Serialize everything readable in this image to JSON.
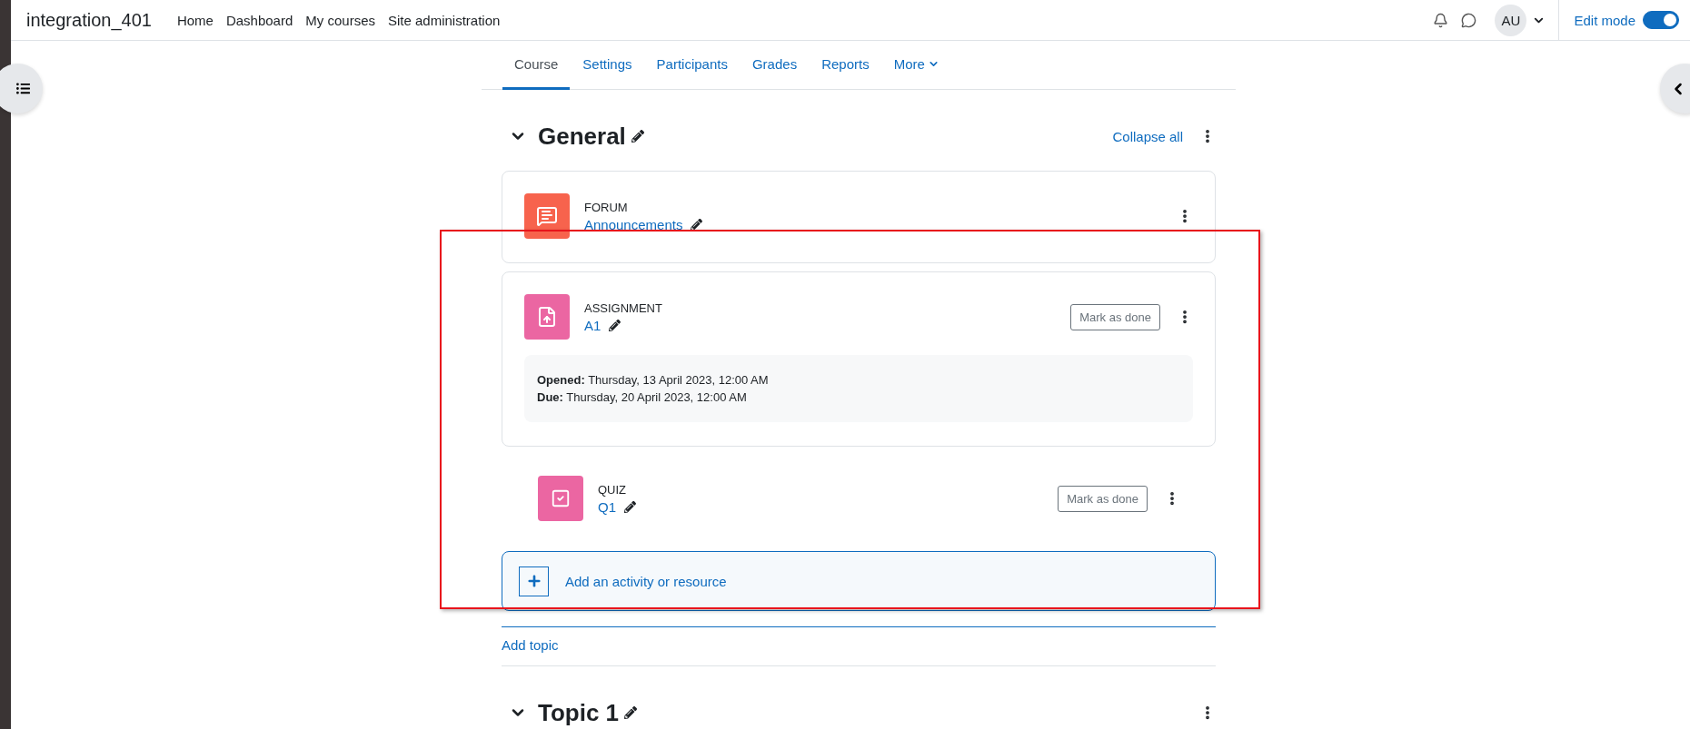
{
  "site_name": "integration_401",
  "nav_links": [
    "Home",
    "Dashboard",
    "My courses",
    "Site administration"
  ],
  "user": {
    "initials": "AU"
  },
  "edit_mode": {
    "label": "Edit mode",
    "on": true
  },
  "tabs": [
    {
      "label": "Course",
      "selected": true,
      "kind": "link"
    },
    {
      "label": "Settings",
      "selected": false,
      "kind": "link"
    },
    {
      "label": "Participants",
      "selected": false,
      "kind": "link"
    },
    {
      "label": "Grades",
      "selected": false,
      "kind": "link"
    },
    {
      "label": "Reports",
      "selected": false,
      "kind": "link"
    },
    {
      "label": "More",
      "selected": false,
      "kind": "dropdown"
    }
  ],
  "collapse_all": "Collapse all",
  "sections": [
    {
      "title": "General",
      "expanded": true,
      "activities": [
        {
          "kind": "forum",
          "type": "FORUM",
          "name": "Announcements",
          "framed": true
        },
        {
          "kind": "assignment",
          "type": "ASSIGNMENT",
          "name": "A1",
          "framed": true,
          "completion_button": "Mark as done",
          "dates": [
            {
              "label": "Opened:",
              "value": "Thursday, 13 April 2023, 12:00 AM"
            },
            {
              "label": "Due:",
              "value": "Thursday, 20 April 2023, 12:00 AM"
            }
          ]
        },
        {
          "kind": "quiz",
          "type": "QUIZ",
          "name": "Q1",
          "framed": false,
          "completion_button": "Mark as done"
        }
      ],
      "add_activity": "Add an activity or resource",
      "add_topic": "Add topic"
    },
    {
      "title": "Topic 1",
      "expanded": true
    }
  ]
}
